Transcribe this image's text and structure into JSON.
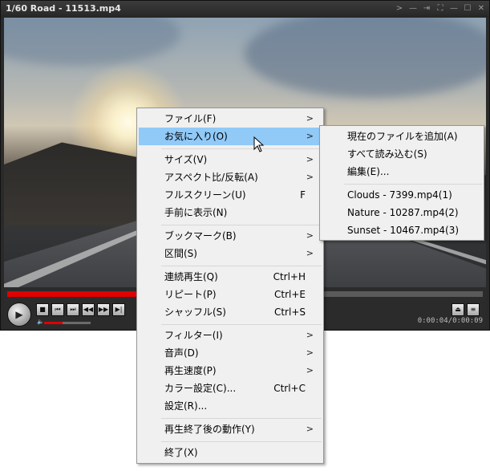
{
  "window": {
    "title": "1/60 Road - 11513.mp4",
    "controls": [
      "expand-icon",
      "pin-icon",
      "dock-icon",
      "fullscreen-icon",
      "minimize-icon",
      "maximize-icon",
      "close-icon"
    ]
  },
  "player": {
    "seek_progress": 0.445,
    "volume_level": 0.4,
    "time_display": "0:00:04/0:00:09"
  },
  "main_menu": {
    "items": [
      {
        "label": "ファイル(F)",
        "shortcut": "",
        "submenu": true
      },
      {
        "label": "お気に入り(O)",
        "shortcut": "",
        "submenu": true,
        "highlighted": true
      },
      {
        "label": "サイズ(V)",
        "shortcut": "",
        "submenu": true
      },
      {
        "label": "アスペクト比/反転(A)",
        "shortcut": "",
        "submenu": true
      },
      {
        "label": "フルスクリーン(U)",
        "shortcut": "F",
        "submenu": false
      },
      {
        "label": "手前に表示(N)",
        "shortcut": "",
        "submenu": false
      },
      {
        "label": "ブックマーク(B)",
        "shortcut": "",
        "submenu": true
      },
      {
        "label": "区間(S)",
        "shortcut": "",
        "submenu": true
      },
      {
        "label": "連続再生(Q)",
        "shortcut": "Ctrl+H",
        "submenu": false
      },
      {
        "label": "リピート(P)",
        "shortcut": "Ctrl+E",
        "submenu": false
      },
      {
        "label": "シャッフル(S)",
        "shortcut": "Ctrl+S",
        "submenu": false
      },
      {
        "label": "フィルター(I)",
        "shortcut": "",
        "submenu": true
      },
      {
        "label": "音声(D)",
        "shortcut": "",
        "submenu": true
      },
      {
        "label": "再生速度(P)",
        "shortcut": "",
        "submenu": true
      },
      {
        "label": "カラー設定(C)...",
        "shortcut": "Ctrl+C",
        "submenu": false
      },
      {
        "label": "設定(R)...",
        "shortcut": "",
        "submenu": false
      },
      {
        "label": "再生終了後の動作(Y)",
        "shortcut": "",
        "submenu": true
      },
      {
        "label": "終了(X)",
        "shortcut": "",
        "submenu": false
      }
    ]
  },
  "favorites_menu": {
    "items": [
      {
        "label": "現在のファイルを追加(A)"
      },
      {
        "label": "すべて読み込む(S)"
      },
      {
        "label": "編集(E)..."
      },
      {
        "label": "Clouds - 7399.mp4(1)"
      },
      {
        "label": "Nature - 10287.mp4(2)"
      },
      {
        "label": "Sunset - 10467.mp4(3)"
      }
    ]
  },
  "colors": {
    "seek_fill": "#e00000",
    "menu_highlight": "#91c9f7",
    "menu_bg": "#f0f0f0"
  }
}
